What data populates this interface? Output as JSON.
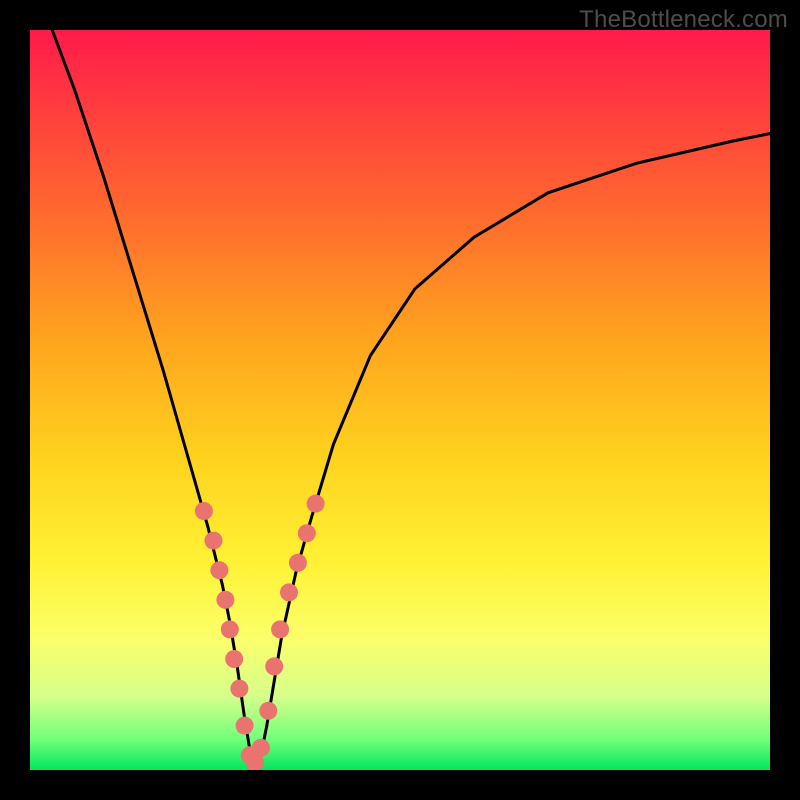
{
  "watermark": "TheBottleneck.com",
  "gradient_colors": {
    "top": "#ff1a4b",
    "mid_upper": "#ff6a2e",
    "mid": "#ffd21e",
    "mid_lower": "#fcff6a",
    "bottom": "#00e65c"
  },
  "chart_data": {
    "type": "line",
    "title": "",
    "xlabel": "",
    "ylabel": "",
    "xlim": [
      0,
      100
    ],
    "ylim": [
      0,
      100
    ],
    "grid": false,
    "legend": false,
    "series": [
      {
        "name": "curve",
        "x": [
          3,
          6,
          10,
          14,
          18,
          22,
          24,
          26,
          27,
          28,
          29,
          30,
          31,
          32,
          33,
          34,
          36,
          38,
          41,
          46,
          52,
          60,
          70,
          82,
          95,
          100
        ],
        "y": [
          100,
          92,
          80,
          67,
          54,
          40,
          33,
          25,
          20,
          14,
          7,
          1,
          1,
          6,
          12,
          18,
          27,
          34,
          44,
          56,
          65,
          72,
          78,
          82,
          85,
          86
        ]
      },
      {
        "name": "markers",
        "x": [
          23.5,
          24.8,
          25.6,
          26.4,
          27.0,
          27.6,
          28.3,
          29.0,
          29.7,
          30.4,
          31.2,
          32.2,
          33.0,
          33.8,
          35.0,
          36.2,
          37.4,
          38.6
        ],
        "y": [
          35,
          31,
          27,
          23,
          19,
          15,
          11,
          6,
          2,
          1,
          3,
          8,
          14,
          19,
          24,
          28,
          32,
          36
        ]
      }
    ],
    "curve_color": "#000000",
    "marker_color": "#e9736f",
    "marker_radius_px": 9
  }
}
